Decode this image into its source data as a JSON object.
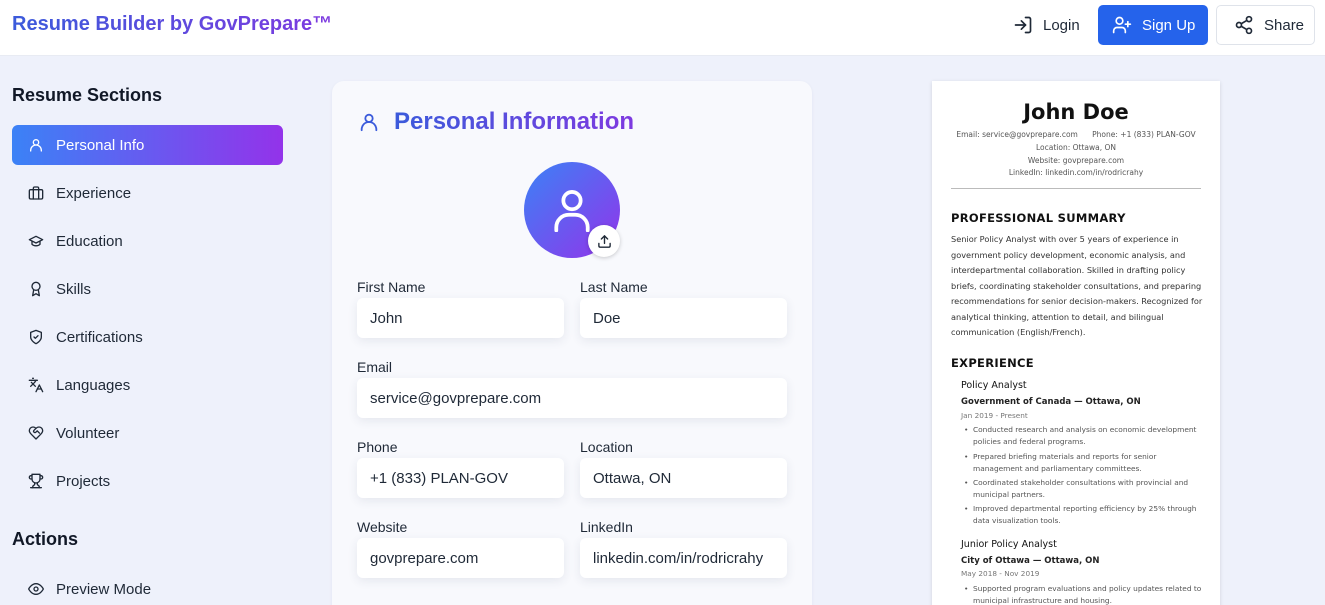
{
  "header": {
    "brand": "Resume Builder by GovPrepare™",
    "login_label": "Login",
    "signup_label": "Sign Up",
    "share_label": "Share",
    "signup_color": "#2563eb"
  },
  "sidebar": {
    "sections_title": "Resume Sections",
    "items": [
      {
        "label": "Personal Info",
        "icon": "user-icon"
      },
      {
        "label": "Experience",
        "icon": "briefcase-icon"
      },
      {
        "label": "Education",
        "icon": "graduation-cap-icon"
      },
      {
        "label": "Skills",
        "icon": "award-icon"
      },
      {
        "label": "Certifications",
        "icon": "shield-check-icon"
      },
      {
        "label": "Languages",
        "icon": "translate-icon"
      },
      {
        "label": "Volunteer",
        "icon": "heart-handshake-icon"
      },
      {
        "label": "Projects",
        "icon": "trophy-icon"
      }
    ],
    "active_index": 0,
    "actions_title": "Actions",
    "actions": [
      {
        "label": "Preview Mode",
        "icon": "eye-icon"
      }
    ]
  },
  "form": {
    "title": "Personal Information",
    "fields": {
      "first_name": {
        "label": "First Name",
        "value": "John"
      },
      "last_name": {
        "label": "Last Name",
        "value": "Doe"
      },
      "email": {
        "label": "Email",
        "value": "service@govprepare.com"
      },
      "phone": {
        "label": "Phone",
        "value": "+1 (833) PLAN-GOV"
      },
      "location": {
        "label": "Location",
        "value": "Ottawa, ON"
      },
      "website": {
        "label": "Website",
        "value": "govprepare.com"
      },
      "linkedin": {
        "label": "LinkedIn",
        "value": "linkedin.com/in/rodricrahy"
      }
    }
  },
  "preview": {
    "name": "John Doe",
    "contact_email": "Email: service@govprepare.com",
    "contact_phone": "Phone: +1 (833) PLAN-GOV",
    "contact_location": "Location: Ottawa, ON",
    "contact_website": "Website: govprepare.com",
    "contact_linkedin": "LinkedIn: linkedin.com/in/rodricrahy",
    "summary_heading": "PROFESSIONAL SUMMARY",
    "summary": "Senior Policy Analyst with over 5 years of experience in government policy development, economic analysis, and interdepartmental collaboration. Skilled in drafting policy briefs, coordinating stakeholder consultations, and preparing recommendations for senior decision-makers. Recognized for analytical thinking, attention to detail, and bilingual communication (English/French).",
    "experience_heading": "EXPERIENCE",
    "jobs": [
      {
        "role": "Policy Analyst",
        "org": "Government of Canada — Ottawa, ON",
        "dates": "Jan 2019 - Present",
        "bullets": [
          "Conducted research and analysis on economic development policies and federal programs.",
          "Prepared briefing materials and reports for senior management and parliamentary committees.",
          "Coordinated stakeholder consultations with provincial and municipal partners.",
          "Improved departmental reporting efficiency by 25% through data visualization tools."
        ]
      },
      {
        "role": "Junior Policy Analyst",
        "org": "City of Ottawa — Ottawa, ON",
        "dates": "May 2018 - Nov 2019",
        "bullets": [
          "Supported program evaluations and policy updates related to municipal infrastructure and housing."
        ]
      }
    ]
  }
}
